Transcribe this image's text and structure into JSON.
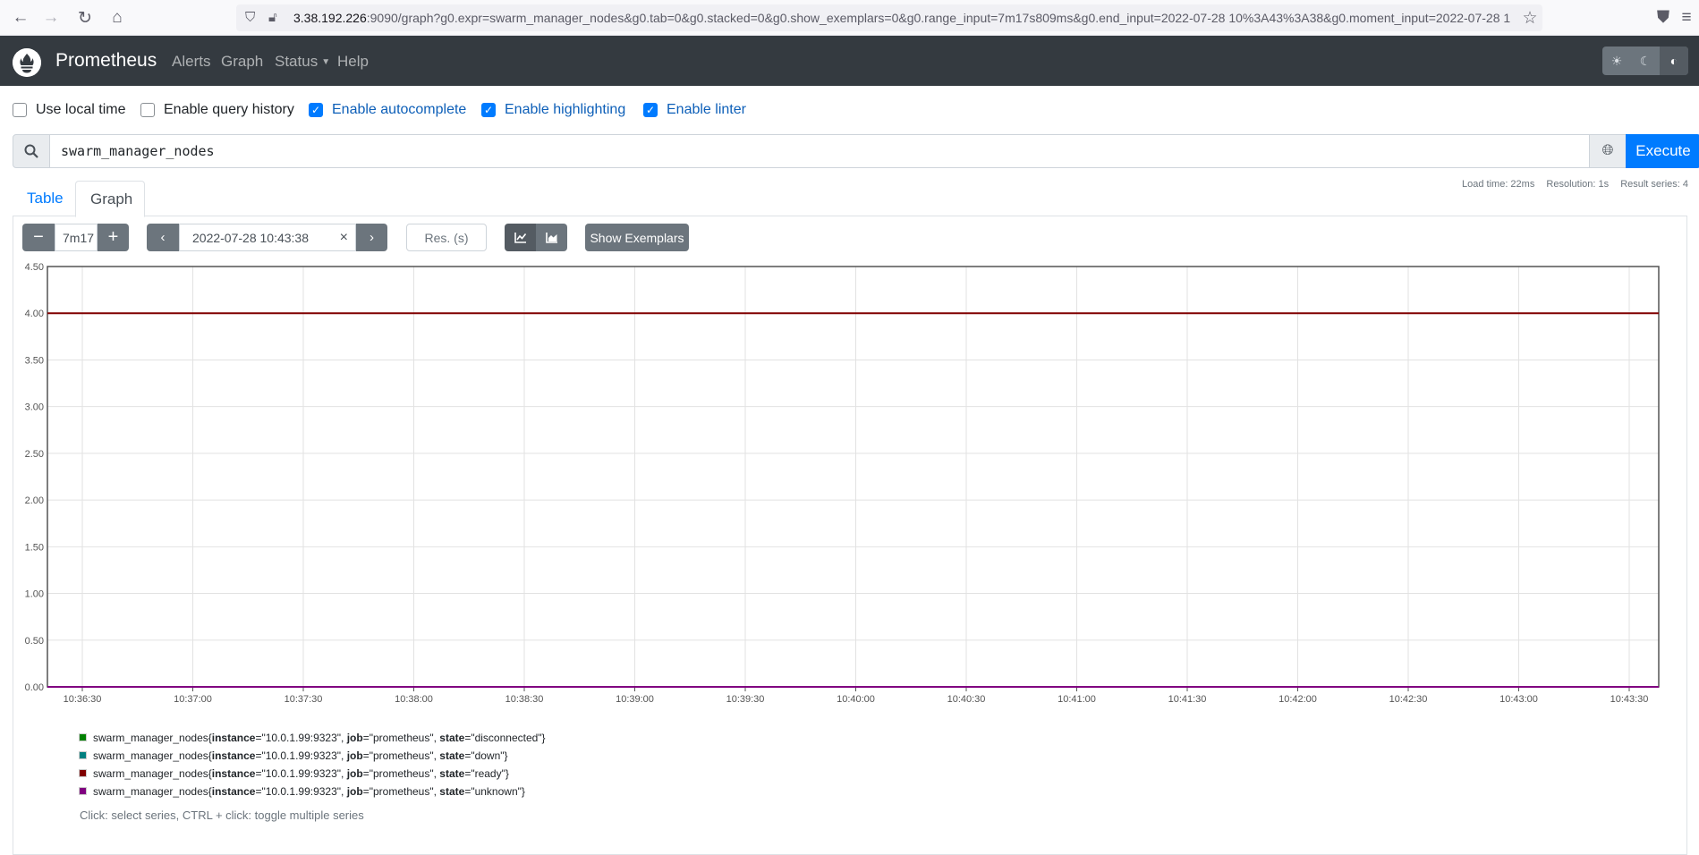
{
  "browser": {
    "url_host": "3.38.192.226",
    "url_rest": ":9090/graph?g0.expr=swarm_manager_nodes&g0.tab=0&g0.stacked=0&g0.show_exemplars=0&g0.range_input=7m17s809ms&g0.end_input=2022-07-28 10%3A43%3A38&g0.moment_input=2022-07-28 1"
  },
  "navbar": {
    "brand": "Prometheus",
    "links": [
      "Alerts",
      "Graph",
      "Status",
      "Help"
    ]
  },
  "options": [
    {
      "label": "Use local time",
      "checked": false
    },
    {
      "label": "Enable query history",
      "checked": false
    },
    {
      "label": "Enable autocomplete",
      "checked": true
    },
    {
      "label": "Enable highlighting",
      "checked": true
    },
    {
      "label": "Enable linter",
      "checked": true
    }
  ],
  "query": {
    "expression": "swarm_manager_nodes",
    "execute_label": "Execute"
  },
  "stats": {
    "load_time": "Load time: 22ms",
    "resolution": "Resolution: 1s",
    "result_series": "Result series: 4"
  },
  "tabs": {
    "table": "Table",
    "graph": "Graph"
  },
  "controls": {
    "minus": "−",
    "range": "7m17",
    "plus": "+",
    "end_time": "2022-07-28 10:43:38",
    "clear": "×",
    "resolution_placeholder": "Res. (s)",
    "show_exemplars": "Show Exemplars"
  },
  "chart_data": {
    "type": "line",
    "ylim": [
      0,
      4.5
    ],
    "y_ticks": [
      "0.00",
      "0.50",
      "1.00",
      "1.50",
      "2.00",
      "2.50",
      "3.00",
      "3.50",
      "4.00",
      "4.50"
    ],
    "x_ticks": [
      "10:36:30",
      "10:37:00",
      "10:37:30",
      "10:38:00",
      "10:38:30",
      "10:39:00",
      "10:39:30",
      "10:40:00",
      "10:40:30",
      "10:41:00",
      "10:41:30",
      "10:42:00",
      "10:42:30",
      "10:43:00",
      "10:43:30"
    ],
    "grid": true,
    "series": [
      {
        "color": "#008000",
        "value": 0
      },
      {
        "color": "#008080",
        "value": 0
      },
      {
        "color": "#800000",
        "value": 4
      },
      {
        "color": "#800080",
        "value": 0
      }
    ]
  },
  "legend": [
    {
      "metric": "swarm_manager_nodes",
      "instance": "10.0.1.99:9323",
      "job": "prometheus",
      "state": "disconnected",
      "color": "#008000"
    },
    {
      "metric": "swarm_manager_nodes",
      "instance": "10.0.1.99:9323",
      "job": "prometheus",
      "state": "down",
      "color": "#008080"
    },
    {
      "metric": "swarm_manager_nodes",
      "instance": "10.0.1.99:9323",
      "job": "prometheus",
      "state": "ready",
      "color": "#800000"
    },
    {
      "metric": "swarm_manager_nodes",
      "instance": "10.0.1.99:9323",
      "job": "prometheus",
      "state": "unknown",
      "color": "#800080"
    }
  ],
  "legend_hint": "Click: select series, CTRL + click: toggle multiple series"
}
